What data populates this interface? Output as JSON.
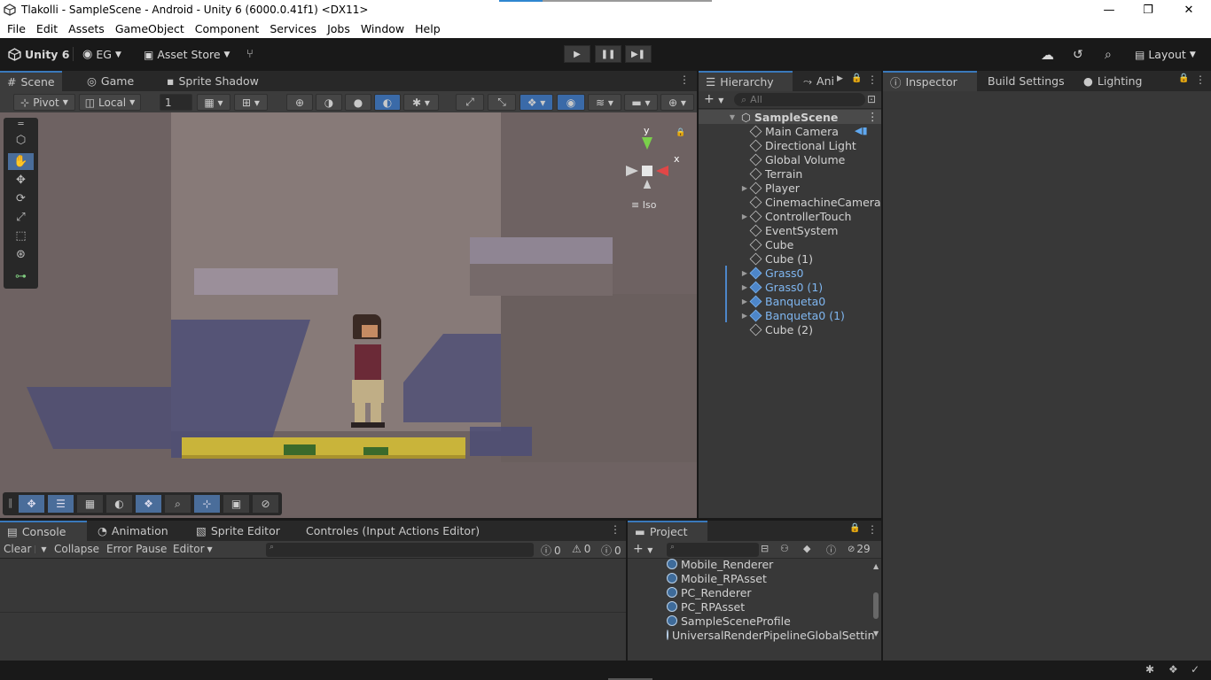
{
  "window": {
    "title": "Tlakolli - SampleScene - Android - Unity 6 (6000.0.41f1) <DX11>",
    "controls": [
      "—",
      "❐",
      "✕"
    ]
  },
  "menu": [
    "File",
    "Edit",
    "Assets",
    "GameObject",
    "Component",
    "Services",
    "Jobs",
    "Window",
    "Help"
  ],
  "toolbar": {
    "unity_label": "Unity 6",
    "account": "EG",
    "asset_store": "Asset Store",
    "layout": "Layout"
  },
  "scene_tabs": [
    "Scene",
    "Game",
    "Sprite Shadow"
  ],
  "scene_toolbar": {
    "pivot": "Pivot",
    "local": "Local",
    "grid_value": "1"
  },
  "gizmo": {
    "y": "y",
    "x": "x",
    "mode": "Iso"
  },
  "hierarchy": {
    "tabs": [
      "Hierarchy",
      "Ani"
    ],
    "search_placeholder": "All",
    "scene": "SampleScene",
    "items": [
      {
        "label": "Main Camera",
        "expand": false,
        "blue": false
      },
      {
        "label": "Directional Light",
        "expand": false,
        "blue": false
      },
      {
        "label": "Global Volume",
        "expand": false,
        "blue": false
      },
      {
        "label": "Terrain",
        "expand": false,
        "blue": false
      },
      {
        "label": "Player",
        "expand": true,
        "blue": false
      },
      {
        "label": "CinemachineCamera",
        "expand": false,
        "blue": false
      },
      {
        "label": "ControllerTouch",
        "expand": true,
        "blue": false
      },
      {
        "label": "EventSystem",
        "expand": false,
        "blue": false
      },
      {
        "label": "Cube",
        "expand": false,
        "blue": false
      },
      {
        "label": "Cube (1)",
        "expand": false,
        "blue": false
      },
      {
        "label": "Grass0",
        "expand": true,
        "blue": true
      },
      {
        "label": "Grass0 (1)",
        "expand": true,
        "blue": true
      },
      {
        "label": "Banqueta0",
        "expand": true,
        "blue": true
      },
      {
        "label": "Banqueta0 (1)",
        "expand": true,
        "blue": true
      },
      {
        "label": "Cube (2)",
        "expand": false,
        "blue": false
      }
    ]
  },
  "inspector_tabs": [
    "Inspector",
    "Build Settings",
    "Lighting"
  ],
  "bottom_tabs": [
    "Console",
    "Animation",
    "Sprite Editor",
    "Controles (Input Actions Editor)"
  ],
  "console": {
    "clear": "Clear",
    "collapse": "Collapse",
    "error_pause": "Error Pause",
    "editor": "Editor",
    "count_info": "0",
    "count_warn": "0",
    "count_error": "0"
  },
  "project": {
    "tab": "Project",
    "hidden_count": "29",
    "items": [
      {
        "label": "Mobile_Renderer",
        "expand": false
      },
      {
        "label": "Mobile_RPAsset",
        "expand": false
      },
      {
        "label": "PC_Renderer",
        "expand": true
      },
      {
        "label": "PC_RPAsset",
        "expand": false
      },
      {
        "label": "SampleSceneProfile",
        "expand": false
      },
      {
        "label": "UniversalRenderPipelineGlobalSettings",
        "expand": false
      }
    ]
  }
}
